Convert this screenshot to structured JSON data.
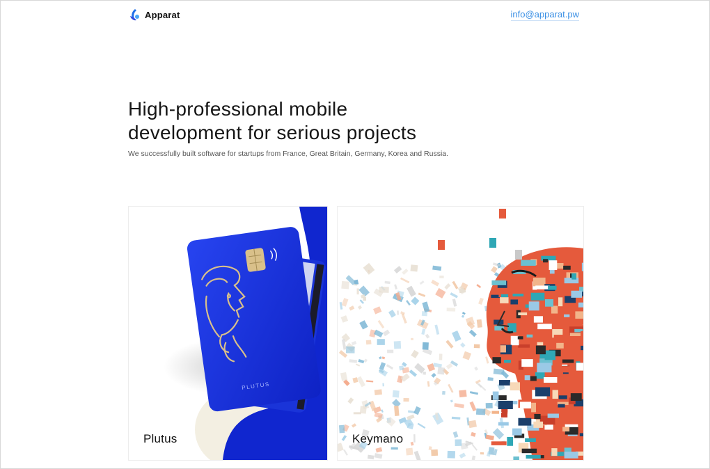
{
  "header": {
    "brand": "Apparat",
    "logo_icon": "apparat-logo-icon",
    "email": "info@apparat.pw"
  },
  "hero": {
    "title_line1": "High-professional mobile",
    "title_line2": "development for serious projects",
    "subtitle": "We successfully built software for startups from France, Great Britain, Germany, Korea and Russia."
  },
  "projects": [
    {
      "name": "Plutus",
      "card_text": "PLUTUS",
      "accent": "#1a32d9"
    },
    {
      "name": "Keymano"
    }
  ],
  "colors": {
    "link": "#3a8fe4",
    "plutus_blue": "#1a32d9",
    "gold": "#d9c08a"
  }
}
